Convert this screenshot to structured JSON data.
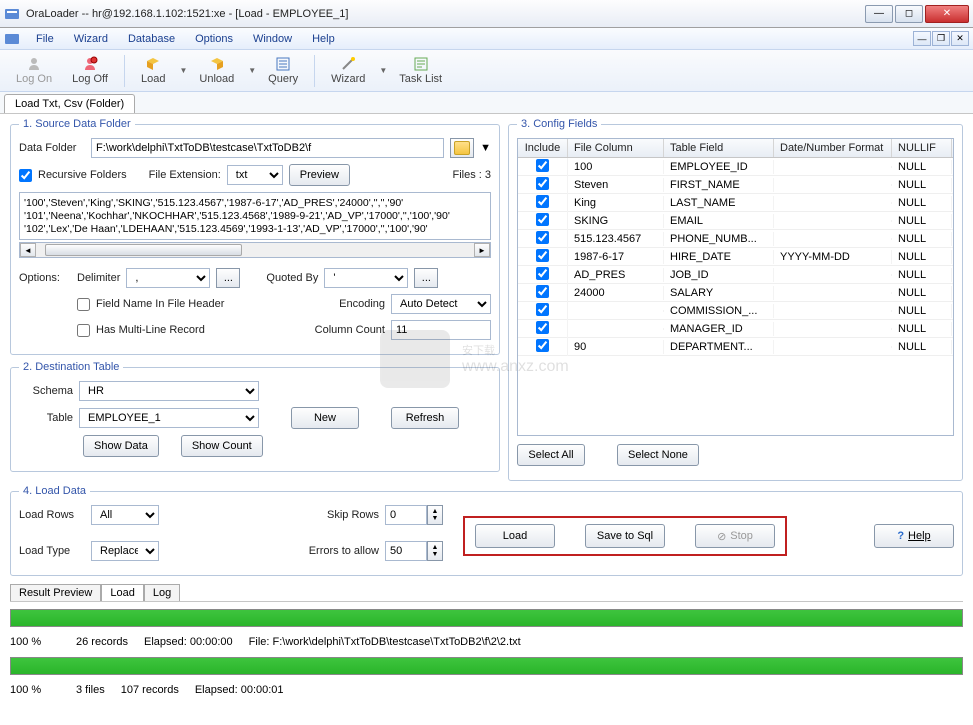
{
  "window": {
    "title": "OraLoader -- hr@192.168.1.102:1521:xe - [Load - EMPLOYEE_1]"
  },
  "menu": {
    "items": [
      "File",
      "Wizard",
      "Database",
      "Options",
      "Window",
      "Help"
    ]
  },
  "toolbar": {
    "logon": "Log On",
    "logoff": "Log Off",
    "load": "Load",
    "unload": "Unload",
    "query": "Query",
    "wizard": "Wizard",
    "tasklist": "Task List"
  },
  "tab": {
    "label": "Load Txt, Csv (Folder)"
  },
  "sec1": {
    "legend": "1. Source Data Folder",
    "dfLabel": "Data Folder",
    "dfValue": "F:\\work\\delphi\\TxtToDB\\testcase\\TxtToDB2\\f",
    "recursive": "Recursive Folders",
    "fileExtLabel": "File Extension:",
    "fileExt": "txt",
    "preview": "Preview",
    "filesLabel": "Files :  3",
    "previewText": "'100','Steven','King','SKING','515.123.4567','1987-6-17','AD_PRES','24000','','','90'\n'101','Neena','Kochhar','NKOCHHAR','515.123.4568','1989-9-21','AD_VP','17000','','100','90'\n'102','Lex','De Haan','LDEHAAN','515.123.4569','1993-1-13','AD_VP','17000','','100','90'",
    "optionsLabel": "Options:",
    "delimiterLabel": "Delimiter",
    "delimiter": ",",
    "quotedByLabel": "Quoted By",
    "quotedBy": "'",
    "fieldHeader": "Field Name In File Header",
    "encodingLabel": "Encoding",
    "encoding": "Auto Detect",
    "multiline": "Has Multi-Line Record",
    "colCountLabel": "Column Count",
    "colCount": "11"
  },
  "sec2": {
    "legend": "2. Destination Table",
    "schemaLabel": "Schema",
    "schema": "HR",
    "tableLabel": "Table",
    "table": "EMPLOYEE_1",
    "new": "New",
    "refresh": "Refresh",
    "showData": "Show Data",
    "showCount": "Show Count"
  },
  "sec3": {
    "legend": "3. Config Fields",
    "cols": {
      "include": "Include",
      "fileCol": "File Column",
      "tableField": "Table Field",
      "dateFmt": "Date/Number Format",
      "nullif": "NULLIF"
    },
    "rows": [
      {
        "fc": "100",
        "tf": "EMPLOYEE_ID",
        "df": "",
        "nf": "NULL"
      },
      {
        "fc": "Steven",
        "tf": "FIRST_NAME",
        "df": "",
        "nf": "NULL"
      },
      {
        "fc": "King",
        "tf": "LAST_NAME",
        "df": "",
        "nf": "NULL"
      },
      {
        "fc": "SKING",
        "tf": "EMAIL",
        "df": "",
        "nf": "NULL"
      },
      {
        "fc": "515.123.4567",
        "tf": "PHONE_NUMB...",
        "df": "",
        "nf": "NULL"
      },
      {
        "fc": "1987-6-17",
        "tf": "HIRE_DATE",
        "df": "YYYY-MM-DD",
        "nf": "NULL"
      },
      {
        "fc": "AD_PRES",
        "tf": "JOB_ID",
        "df": "",
        "nf": "NULL"
      },
      {
        "fc": "24000",
        "tf": "SALARY",
        "df": "",
        "nf": "NULL"
      },
      {
        "fc": "",
        "tf": "COMMISSION_...",
        "df": "",
        "nf": "NULL"
      },
      {
        "fc": "",
        "tf": "MANAGER_ID",
        "df": "",
        "nf": "NULL"
      },
      {
        "fc": "90",
        "tf": "DEPARTMENT...",
        "df": "",
        "nf": "NULL"
      }
    ],
    "selectAll": "Select All",
    "selectNone": "Select None"
  },
  "sec4": {
    "legend": "4. Load Data",
    "loadRowsLabel": "Load Rows",
    "loadRows": "All",
    "loadTypeLabel": "Load Type",
    "loadType": "Replace",
    "skipRowsLabel": "Skip Rows",
    "skipRows": "0",
    "errorsLabel": "Errors to allow",
    "errors": "50",
    "load": "Load",
    "save": "Save to Sql",
    "stop": "Stop",
    "help": "Help"
  },
  "results": {
    "tabs": [
      "Result Preview",
      "Load",
      "Log"
    ],
    "row1": {
      "pct": "100 %",
      "rec": "26 records",
      "elapsed": "Elapsed: 00:00:00",
      "file": "File: F:\\work\\delphi\\TxtToDB\\testcase\\TxtToDB2\\f\\2\\2.txt"
    },
    "row2": {
      "pct": "100 %",
      "files": "3 files",
      "rec": "107 records",
      "elapsed": "Elapsed: 00:00:01"
    }
  }
}
